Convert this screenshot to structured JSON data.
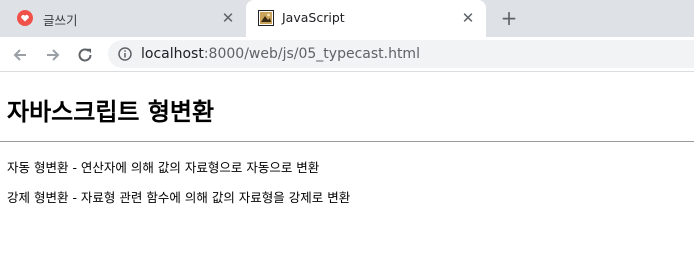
{
  "tabs": [
    {
      "title": "글쓰기",
      "favicon": "heart-favicon-icon",
      "active": false
    },
    {
      "title": "JavaScript",
      "favicon": "image-favicon-icon",
      "active": true
    }
  ],
  "toolbar": {
    "url_host": "localhost",
    "url_rest": ":8000/web/js/05_typecast.html"
  },
  "page": {
    "heading": "자바스크립트 형변환",
    "paragraphs": [
      "자동 형변환 - 연산자에 의해 값의 자료형으로 자동으로 변환",
      "강제 형변환 - 자료형 관련 함수에 의해 값의 자료형을 강제로 변환"
    ]
  },
  "colors": {
    "tabstrip": "#dee1e6",
    "omnibox": "#f1f3f4",
    "favicon_red": "#f0524a"
  }
}
